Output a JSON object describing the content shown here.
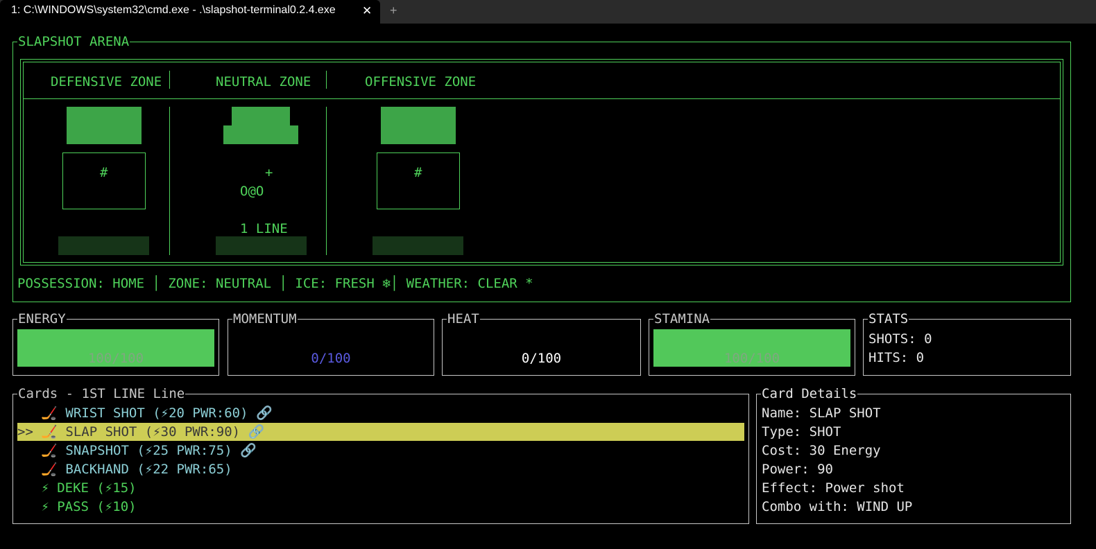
{
  "window": {
    "tab_title": "1: C:\\WINDOWS\\system32\\cmd.exe - .\\slapshot-terminal0.2.4.exe",
    "close_glyph": "✕",
    "new_tab_glyph": "+"
  },
  "arena": {
    "title": "SLAPSHOT ARENA",
    "zones": [
      "DEFENSIVE ZONE",
      "NEUTRAL ZONE",
      "OFFENSIVE ZONE"
    ],
    "defensive_goal": "#",
    "offensive_goal": "#",
    "puck_marker": "+",
    "players": "O@O",
    "line_label": "1 LINE",
    "status": {
      "possession": "POSSESSION: HOME",
      "zone": "ZONE: NEUTRAL",
      "ice": "ICE: FRESH ❄",
      "weather": "WEATHER: CLEAR *"
    }
  },
  "meters": [
    {
      "label": "ENERGY",
      "value_text": "100/100",
      "value": 100,
      "color": "#52c85a",
      "text_color": "#7fa880"
    },
    {
      "label": "MOMENTUM",
      "value_text": "0/100",
      "value": 0,
      "color": "#5a5ae0",
      "text_color": "#5a5ae0"
    },
    {
      "label": "HEAT",
      "value_text": "0/100",
      "value": 0,
      "color": "#ffffff",
      "text_color": "#ffffff"
    },
    {
      "label": "STAMINA",
      "value_text": "100/100",
      "value": 100,
      "color": "#52c85a",
      "text_color": "#7fa880"
    }
  ],
  "stats": {
    "title": "STATS",
    "shots": "SHOTS: 0",
    "hits": "HITS: 0"
  },
  "cards": {
    "title": "Cards - 1ST LINE Line",
    "items": [
      {
        "text": "   🏒 WRIST SHOT (⚡20 PWR:60) 🔗",
        "selected": false,
        "color": "#8ccfd6"
      },
      {
        "text": ">> 🏒 SLAP SHOT (⚡30 PWR:90) 🔗",
        "selected": true,
        "color": "#383838"
      },
      {
        "text": "   🏒 SNAPSHOT (⚡25 PWR:75) 🔗",
        "selected": false,
        "color": "#8ccfd6"
      },
      {
        "text": "   🏒 BACKHAND (⚡22 PWR:65)",
        "selected": false,
        "color": "#8ccfd6"
      },
      {
        "text": "   ⚡ DEKE (⚡15)",
        "selected": false,
        "color": "#4fd35a"
      },
      {
        "text": "   ⚡ PASS (⚡10)",
        "selected": false,
        "color": "#4fd35a"
      }
    ]
  },
  "details": {
    "title": "Card Details",
    "name": "Name: SLAP SHOT",
    "type": "Type: SHOT",
    "cost": "Cost: 30 Energy",
    "power": "Power: 90",
    "effect": "Effect: Power shot",
    "combo": "Combo with: WIND UP"
  }
}
